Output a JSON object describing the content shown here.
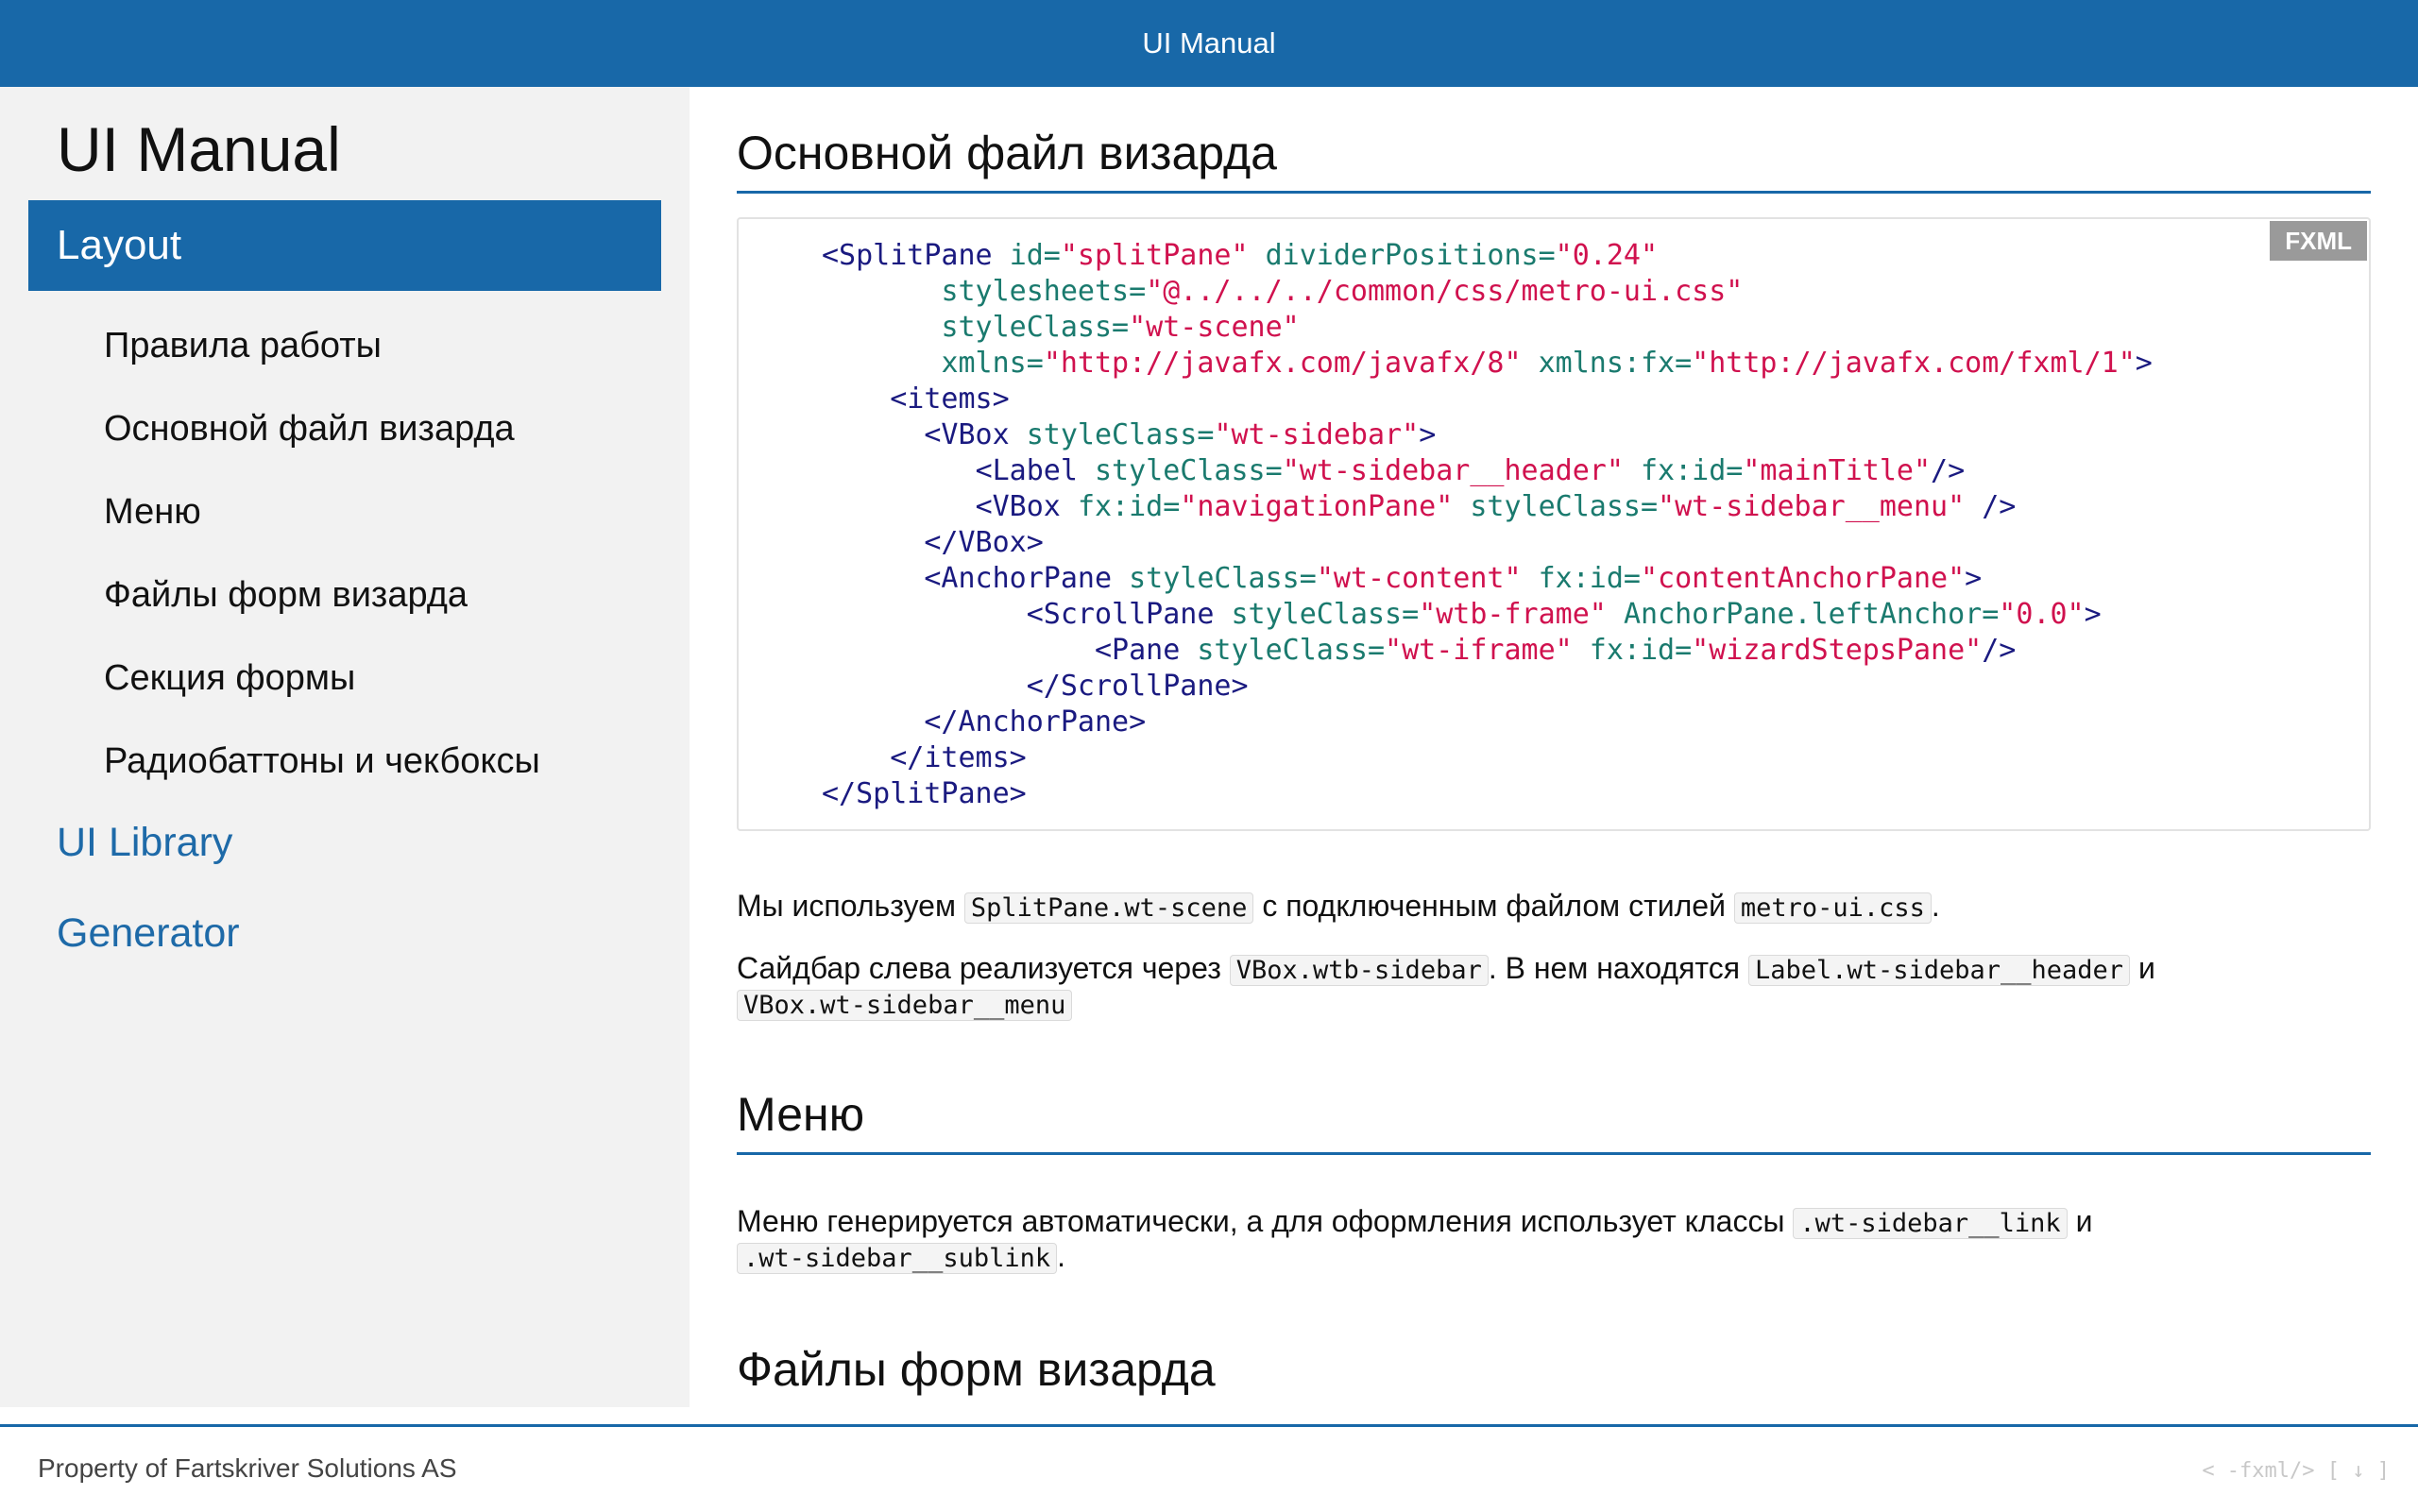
{
  "header": {
    "title": "UI Manual"
  },
  "sidebar": {
    "title": "UI Manual",
    "active_item": "Layout",
    "subitems": [
      "Правила работы",
      "Основной файл визарда",
      "Меню",
      "Файлы форм визарда",
      "Секция формы",
      "Радиобаттоны и чекбоксы"
    ],
    "links": [
      "UI Library",
      "Generator"
    ]
  },
  "content": {
    "section1_title": "Основной файл визарда",
    "code_badge": "FXML",
    "para1": {
      "t1": "Мы используем ",
      "c1": "SplitPane.wt-scene",
      "t2": " с подключенным файлом стилей ",
      "c2": "metro-ui.css",
      "t3": "."
    },
    "para2": {
      "t1": "Сайдбар слева реализуется через ",
      "c1": "VBox.wtb-sidebar",
      "t2": ". В нем находятся ",
      "c2": "Label.wt-sidebar__header",
      "t3": " и ",
      "c3": "VBox.wt-sidebar__menu"
    },
    "section2_title": "Меню",
    "para3": {
      "t1": "Меню генерируется автоматически, а для оформления использует классы ",
      "c1": ".wt-sidebar__link",
      "t2": " и ",
      "c2": ".wt-sidebar__sublink",
      "t3": "."
    },
    "section3_title": "Файлы форм визарда"
  },
  "footer": {
    "text": "Property of Fartskriver Solutions AS",
    "icons": "< -fxml/>  [ ↓ ]"
  }
}
